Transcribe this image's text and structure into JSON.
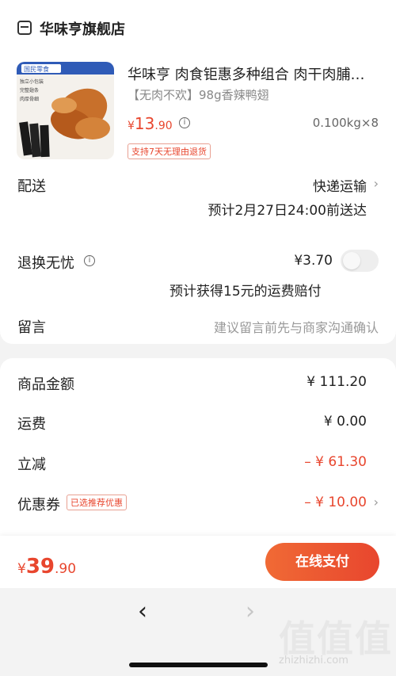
{
  "store": {
    "name": "华味亨旗舰店",
    "icon": "store-icon"
  },
  "product": {
    "title": "华味亨 肉食钜惠多种组合 肉干肉脯…",
    "sku": "【无肉不欢】98g香辣鸭翅",
    "price_symbol": "¥",
    "price_int": "13",
    "price_dec": ".90",
    "spec": "0.100kg×8",
    "return_tag": "支持7天无理由退货",
    "image_label_brand": "国民零食",
    "image_label_1": "独立小包装",
    "image_label_2": "完整翅条",
    "image_label_3": "肉厚骨细"
  },
  "shipping": {
    "label": "配送",
    "method": "快递运输",
    "eta": "预计2月27日24:00前送达"
  },
  "return_insurance": {
    "label": "退换无忧",
    "price": "¥3.70",
    "note": "预计获得15元的运费赔付",
    "enabled": false
  },
  "message": {
    "label": "留言",
    "placeholder": "建议留言前先与商家沟通确认"
  },
  "summary": {
    "goods_label": "商品金额",
    "goods_value": "¥ 111.20",
    "freight_label": "运费",
    "freight_value": "¥ 0.00",
    "discount_label": "立减",
    "discount_value": "– ¥ 61.30",
    "coupon_label": "优惠券",
    "coupon_tag": "已选推荐优惠",
    "coupon_value": "– ¥ 10.00"
  },
  "footer": {
    "total_symbol": "¥",
    "total_int": "39",
    "total_dec": ".90",
    "pay_label": "在线支付"
  },
  "browser": {
    "back": "‹",
    "forward": "›"
  },
  "watermark": {
    "glyphs": "值值值",
    "text": "zhizhizhi.com"
  },
  "colors": {
    "accent": "#e8462e",
    "background": "#f3f3f3"
  }
}
